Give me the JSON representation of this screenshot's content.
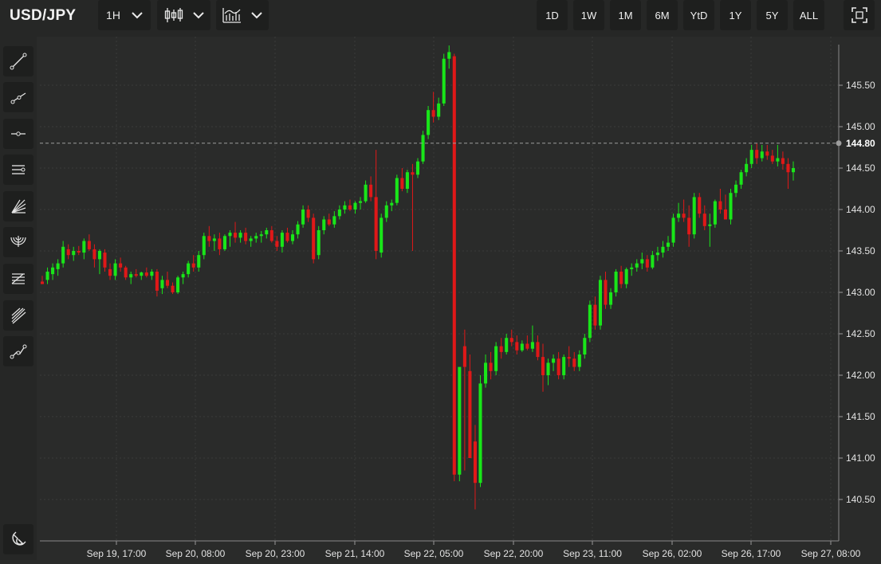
{
  "header": {
    "symbol": "USD/JPY",
    "interval_label": "1H",
    "chart_type_icon": "candlestick-icon",
    "indicators_icon": "indicators-icon",
    "ranges": [
      "1D",
      "1W",
      "1M",
      "6M",
      "YtD",
      "1Y",
      "5Y",
      "ALL"
    ],
    "fullscreen_icon": "fullscreen-icon"
  },
  "sidebar": {
    "tools": [
      "trend-line-icon",
      "ray-icon",
      "horizontal-line-icon",
      "parallel-channel-icon",
      "fan-icon",
      "fibonacci-arc-icon",
      "fibonacci-retracement-icon",
      "pitchfork-icon",
      "polyline-icon"
    ],
    "bottom_tool": "magnet-icon"
  },
  "colors": {
    "up": "#19e619",
    "down": "#e01818",
    "background": "#2a2b2a",
    "grid": "#3a3b3a"
  },
  "chart_data": {
    "type": "candlestick",
    "interval": "1H",
    "current_price_label": "144.80",
    "current_price": 144.8,
    "y_ticks": [
      "145.50",
      "145.00",
      "144.50",
      "144.00",
      "143.50",
      "143.00",
      "142.50",
      "142.00",
      "141.50",
      "141.00",
      "140.50"
    ],
    "y_tick_values": [
      145.5,
      145.0,
      144.5,
      144.0,
      143.5,
      143.0,
      142.5,
      142.0,
      141.5,
      141.0,
      140.5
    ],
    "ylim": [
      140.0,
      146.0
    ],
    "x_ticks": [
      "Sep 19, 17:00",
      "Sep 20, 08:00",
      "Sep 20, 23:00",
      "Sep 21, 14:00",
      "Sep 22, 05:00",
      "Sep 22, 20:00",
      "Sep 23, 11:00",
      "Sep 26, 02:00",
      "Sep 26, 17:00",
      "Sep 27, 08:00"
    ],
    "candles": [
      [
        143.13,
        143.2,
        143.1,
        143.1
      ],
      [
        143.15,
        143.3,
        143.1,
        143.25
      ],
      [
        143.22,
        143.35,
        143.15,
        143.3
      ],
      [
        143.28,
        143.4,
        143.2,
        143.35
      ],
      [
        143.35,
        143.62,
        143.3,
        143.55
      ],
      [
        143.52,
        143.58,
        143.4,
        143.45
      ],
      [
        143.45,
        143.55,
        143.38,
        143.5
      ],
      [
        143.5,
        143.56,
        143.45,
        143.48
      ],
      [
        143.48,
        143.65,
        143.4,
        143.62
      ],
      [
        143.62,
        143.7,
        143.5,
        143.52
      ],
      [
        143.52,
        143.58,
        143.3,
        143.4
      ],
      [
        143.4,
        143.52,
        143.22,
        143.5
      ],
      [
        143.48,
        143.52,
        143.25,
        143.3
      ],
      [
        143.28,
        143.35,
        143.15,
        143.2
      ],
      [
        143.2,
        143.4,
        143.15,
        143.35
      ],
      [
        143.35,
        143.42,
        143.25,
        143.3
      ],
      [
        143.3,
        143.32,
        143.15,
        143.18
      ],
      [
        143.18,
        143.25,
        143.1,
        143.22
      ],
      [
        143.22,
        143.28,
        143.18,
        143.2
      ],
      [
        143.2,
        143.25,
        143.15,
        143.24
      ],
      [
        143.24,
        143.3,
        143.18,
        143.2
      ],
      [
        143.2,
        143.28,
        143.15,
        143.25
      ],
      [
        143.25,
        143.28,
        142.95,
        143.02
      ],
      [
        143.05,
        143.2,
        142.98,
        143.15
      ],
      [
        143.15,
        143.25,
        143.05,
        143.08
      ],
      [
        143.08,
        143.12,
        142.98,
        143.0
      ],
      [
        143.0,
        143.2,
        142.98,
        143.18
      ],
      [
        143.18,
        143.25,
        143.1,
        143.22
      ],
      [
        143.22,
        143.38,
        143.18,
        143.35
      ],
      [
        143.35,
        143.45,
        143.25,
        143.3
      ],
      [
        143.3,
        143.5,
        143.25,
        143.45
      ],
      [
        143.45,
        143.72,
        143.4,
        143.68
      ],
      [
        143.68,
        143.8,
        143.55,
        143.62
      ],
      [
        143.62,
        143.7,
        143.5,
        143.65
      ],
      [
        143.65,
        143.72,
        143.45,
        143.52
      ],
      [
        143.52,
        143.7,
        143.5,
        143.68
      ],
      [
        143.68,
        143.75,
        143.55,
        143.72
      ],
      [
        143.72,
        143.85,
        143.6,
        143.66
      ],
      [
        143.66,
        143.75,
        143.6,
        143.72
      ],
      [
        143.72,
        143.78,
        143.58,
        143.62
      ],
      [
        143.62,
        143.68,
        143.55,
        143.65
      ],
      [
        143.65,
        143.72,
        143.6,
        143.68
      ],
      [
        143.68,
        143.74,
        143.6,
        143.7
      ],
      [
        143.7,
        143.78,
        143.65,
        143.75
      ],
      [
        143.75,
        143.8,
        143.6,
        143.62
      ],
      [
        143.62,
        143.68,
        143.5,
        143.55
      ],
      [
        143.55,
        143.75,
        143.48,
        143.72
      ],
      [
        143.72,
        143.78,
        143.6,
        143.62
      ],
      [
        143.62,
        143.75,
        143.58,
        143.7
      ],
      [
        143.7,
        143.86,
        143.65,
        143.82
      ],
      [
        143.82,
        144.05,
        143.78,
        144.0
      ],
      [
        144.0,
        144.05,
        143.85,
        143.9
      ],
      [
        143.9,
        143.95,
        143.35,
        143.4
      ],
      [
        143.45,
        143.8,
        143.4,
        143.75
      ],
      [
        143.75,
        143.92,
        143.7,
        143.88
      ],
      [
        143.88,
        143.95,
        143.8,
        143.82
      ],
      [
        143.82,
        143.98,
        143.78,
        143.92
      ],
      [
        143.92,
        144.05,
        143.88,
        144.0
      ],
      [
        144.0,
        144.1,
        143.95,
        144.05
      ],
      [
        144.05,
        144.12,
        143.98,
        144.0
      ],
      [
        144.0,
        144.1,
        143.95,
        144.08
      ],
      [
        144.08,
        144.15,
        144.0,
        144.1
      ],
      [
        144.1,
        144.35,
        144.08,
        144.3
      ],
      [
        144.3,
        144.4,
        144.1,
        144.15
      ],
      [
        144.15,
        144.72,
        143.4,
        143.5
      ],
      [
        143.48,
        143.95,
        143.42,
        143.9
      ],
      [
        143.9,
        144.1,
        143.85,
        144.05
      ],
      [
        144.05,
        144.12,
        143.98,
        144.08
      ],
      [
        144.08,
        144.42,
        144.05,
        144.38
      ],
      [
        144.38,
        144.5,
        144.22,
        144.25
      ],
      [
        144.25,
        144.48,
        144.2,
        144.45
      ],
      [
        144.45,
        144.55,
        143.5,
        144.42
      ],
      [
        144.42,
        144.62,
        144.38,
        144.58
      ],
      [
        144.58,
        144.95,
        144.55,
        144.9
      ],
      [
        144.9,
        145.25,
        144.85,
        145.2
      ],
      [
        145.2,
        145.42,
        145.05,
        145.12
      ],
      [
        145.12,
        145.35,
        145.08,
        145.28
      ],
      [
        145.28,
        145.88,
        145.25,
        145.82
      ],
      [
        145.82,
        145.98,
        145.7,
        145.9
      ],
      [
        145.85,
        145.88,
        140.72,
        140.8
      ],
      [
        140.8,
        141.85,
        140.72,
        142.1
      ],
      [
        142.35,
        142.55,
        140.85,
        142.1
      ],
      [
        142.05,
        142.25,
        141.6,
        141.0
      ],
      [
        141.2,
        141.4,
        140.38,
        140.7
      ],
      [
        140.7,
        142.0,
        140.65,
        141.9
      ],
      [
        141.9,
        142.25,
        141.85,
        142.15
      ],
      [
        142.15,
        142.28,
        141.95,
        142.05
      ],
      [
        142.05,
        142.4,
        142.0,
        142.35
      ],
      [
        142.35,
        142.45,
        142.2,
        142.28
      ],
      [
        142.28,
        142.5,
        142.25,
        142.45
      ],
      [
        142.45,
        142.55,
        142.35,
        142.4
      ],
      [
        142.4,
        142.48,
        142.25,
        142.3
      ],
      [
        142.3,
        142.42,
        142.28,
        142.38
      ],
      [
        142.38,
        142.48,
        142.3,
        142.32
      ],
      [
        142.32,
        142.6,
        142.28,
        142.4
      ],
      [
        142.4,
        142.48,
        142.18,
        142.22
      ],
      [
        142.22,
        142.38,
        141.8,
        142.0
      ],
      [
        142.0,
        142.2,
        141.88,
        142.15
      ],
      [
        142.15,
        142.25,
        142.05,
        142.2
      ],
      [
        142.2,
        142.28,
        141.95,
        142.0
      ],
      [
        142.0,
        142.25,
        141.95,
        142.22
      ],
      [
        142.22,
        142.35,
        142.1,
        142.2
      ],
      [
        142.2,
        142.28,
        142.05,
        142.1
      ],
      [
        142.1,
        142.3,
        142.05,
        142.25
      ],
      [
        142.25,
        142.5,
        142.2,
        142.45
      ],
      [
        142.45,
        142.9,
        142.4,
        142.85
      ],
      [
        142.85,
        142.95,
        142.55,
        142.6
      ],
      [
        142.6,
        143.2,
        142.55,
        143.15
      ],
      [
        143.15,
        143.25,
        142.8,
        142.85
      ],
      [
        142.85,
        143.05,
        142.8,
        143.0
      ],
      [
        143.0,
        143.28,
        142.95,
        143.25
      ],
      [
        143.25,
        143.32,
        143.05,
        143.1
      ],
      [
        143.1,
        143.3,
        143.05,
        143.28
      ],
      [
        143.28,
        143.35,
        143.2,
        143.3
      ],
      [
        143.3,
        143.4,
        143.25,
        143.35
      ],
      [
        143.35,
        143.48,
        143.28,
        143.4
      ],
      [
        143.4,
        143.45,
        143.25,
        143.3
      ],
      [
        143.3,
        143.5,
        143.28,
        143.45
      ],
      [
        143.45,
        143.55,
        143.38,
        143.48
      ],
      [
        143.48,
        143.62,
        143.42,
        143.55
      ],
      [
        143.55,
        143.68,
        143.5,
        143.6
      ],
      [
        143.6,
        143.95,
        143.55,
        143.9
      ],
      [
        143.9,
        144.08,
        143.85,
        143.95
      ],
      [
        143.95,
        144.12,
        143.85,
        143.9
      ],
      [
        143.9,
        144.05,
        143.55,
        143.7
      ],
      [
        143.7,
        144.2,
        143.65,
        144.15
      ],
      [
        144.15,
        144.2,
        143.9,
        143.95
      ],
      [
        143.95,
        144.05,
        143.75,
        143.8
      ],
      [
        143.8,
        143.95,
        143.55,
        143.82
      ],
      [
        143.82,
        144.12,
        143.78,
        144.1
      ],
      [
        144.1,
        144.25,
        143.95,
        144.0
      ],
      [
        144.0,
        144.18,
        143.95,
        143.88
      ],
      [
        143.88,
        144.25,
        143.82,
        144.2
      ],
      [
        144.2,
        144.35,
        144.15,
        144.3
      ],
      [
        144.3,
        144.48,
        144.25,
        144.45
      ],
      [
        144.45,
        144.62,
        144.4,
        144.55
      ],
      [
        144.55,
        144.78,
        144.5,
        144.72
      ],
      [
        144.72,
        144.8,
        144.55,
        144.62
      ],
      [
        144.62,
        144.78,
        144.58,
        144.7
      ],
      [
        144.7,
        144.78,
        144.6,
        144.65
      ],
      [
        144.65,
        144.72,
        144.55,
        144.58
      ],
      [
        144.58,
        144.78,
        144.52,
        144.62
      ],
      [
        144.62,
        144.7,
        144.48,
        144.55
      ],
      [
        144.55,
        144.62,
        144.25,
        144.45
      ],
      [
        144.45,
        144.58,
        144.35,
        144.5
      ]
    ]
  }
}
